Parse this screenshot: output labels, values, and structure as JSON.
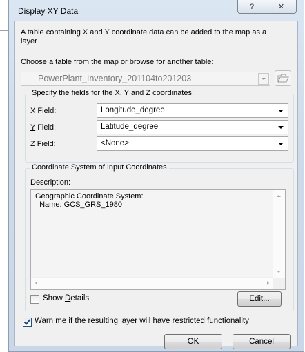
{
  "window": {
    "title": "Display XY Data",
    "help_glyph": "?",
    "close_glyph": "✕"
  },
  "intro_text": "A table containing X and Y coordinate data can be added to the map as a layer",
  "table_prompt": "Choose a table from the map or browse for another table:",
  "table_select": {
    "value": "PowerPlant_Inventory_201104to201203"
  },
  "fields_group": {
    "label": "Specify the fields for the X, Y and Z coordinates:",
    "x": {
      "mnemonic": "X",
      "rest": " Field:",
      "value": "Longitude_degree"
    },
    "y": {
      "mnemonic": "Y",
      "rest": " Field:",
      "value": "Latitude_degree"
    },
    "z": {
      "mnemonic": "Z",
      "rest": " Field:",
      "value": "<None>"
    }
  },
  "coord_group": {
    "label": "Coordinate System of Input Coordinates",
    "description_label": "Description:",
    "description_line1": "Geographic Coordinate System:",
    "description_line2": "  Name: GCS_GRS_1980",
    "show_details": {
      "before": "Show ",
      "mnemonic": "D",
      "after": "etails",
      "checked": false
    },
    "edit_button": {
      "mnemonic": "E",
      "after": "dit..."
    }
  },
  "warn_checkbox": {
    "mnemonic": "W",
    "after": "arn me if the resulting layer will have restricted functionality",
    "checked": true
  },
  "buttons": {
    "ok": "OK",
    "cancel": "Cancel"
  }
}
